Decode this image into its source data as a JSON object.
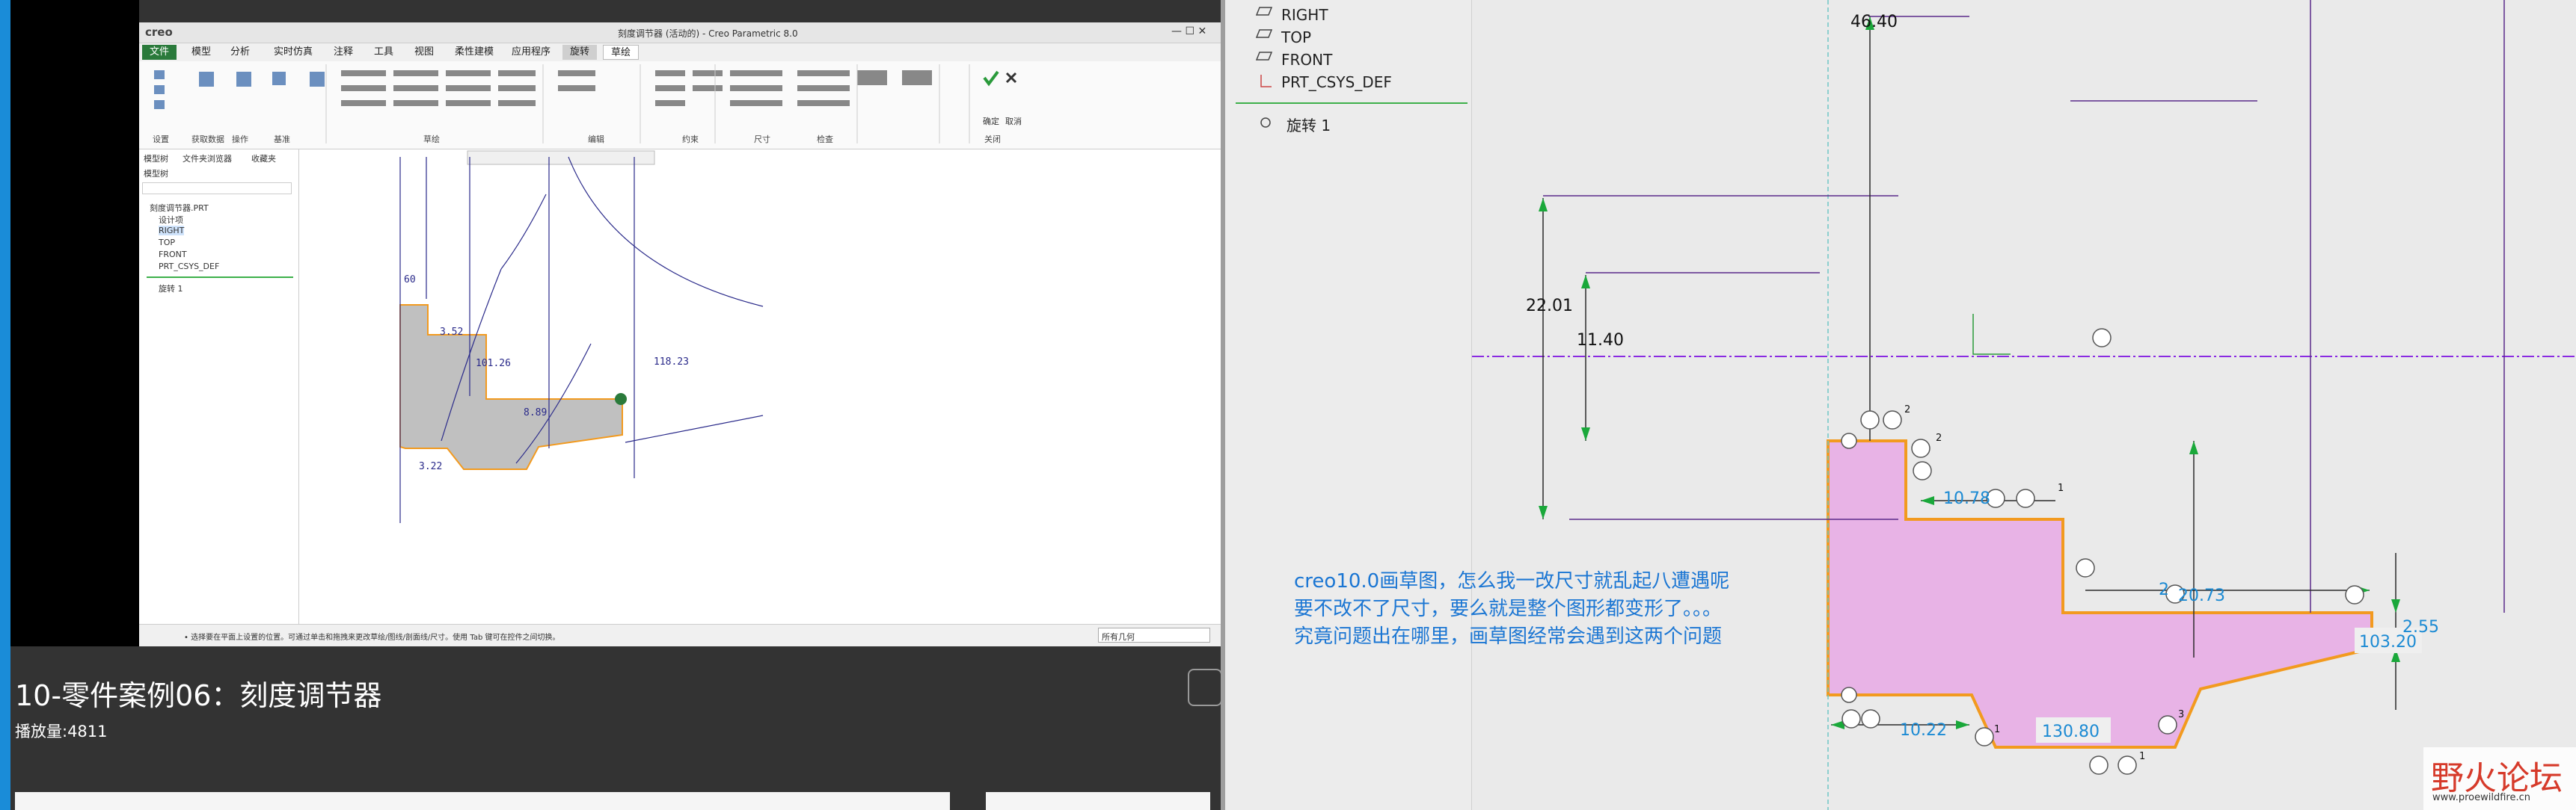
{
  "video": {
    "title": "10-零件案例06：刻度调节器",
    "plays": "播放量:4811"
  },
  "creo": {
    "app_title": "刻度调节器 (活动的) - Creo Parametric 8.0",
    "logo": "creo",
    "tabs": [
      "文件",
      "模型",
      "分析",
      "实时仿真",
      "注释",
      "工具",
      "视图",
      "柔性建模",
      "应用程序",
      "旋转",
      "草绘"
    ],
    "groups": [
      "设置",
      "获取数据",
      "操作",
      "基准",
      "草绘",
      "编辑",
      "约束",
      "尺寸",
      "检查",
      "关闭"
    ],
    "ribbon_labels": {
      "ok": "确定",
      "cancel": "取消"
    },
    "tree_tabs": [
      "模型树",
      "文件夹浏览器",
      "收藏夹"
    ],
    "tree_header": "模型树",
    "tree_items": [
      "刻度调节器.PRT",
      "设计项",
      "RIGHT",
      "TOP",
      "FRONT",
      "PRT_CSYS_DEF",
      "旋转 1"
    ],
    "status_text": "• 选择要在平面上设置的位置。可通过单击和拖拽来更改草绘/图线/剖面线/尺寸。使用 Tab 键可在控件之间切换。",
    "filter": "所有几何",
    "dims": [
      "60",
      "3.52",
      "101.26",
      "118.23",
      "8.89",
      "3.22"
    ]
  },
  "right_tree": {
    "items": [
      "RIGHT",
      "TOP",
      "FRONT",
      "PRT_CSYS_DEF",
      "旋转 1"
    ]
  },
  "sketch": {
    "dims": [
      "46.40",
      "22.01",
      "11.40",
      "10.78",
      "2",
      "20.73",
      "2.55",
      "103.20",
      "10.22",
      "130.80"
    ],
    "constraints": [
      "2",
      "2",
      "1",
      "1",
      "3",
      "1"
    ]
  },
  "annotation": {
    "line1": "creo10.0画草图，怎么我一改尺寸就乱起八遭遇呢",
    "line2": "要不改不了尺寸，要么就是整个图形都变形了。。。",
    "line3": "究竟问题出在哪里，画草图经常会遇到这两个问题"
  },
  "watermark": {
    "main": "野火论坛",
    "url": "www.proewildfire.cn"
  }
}
